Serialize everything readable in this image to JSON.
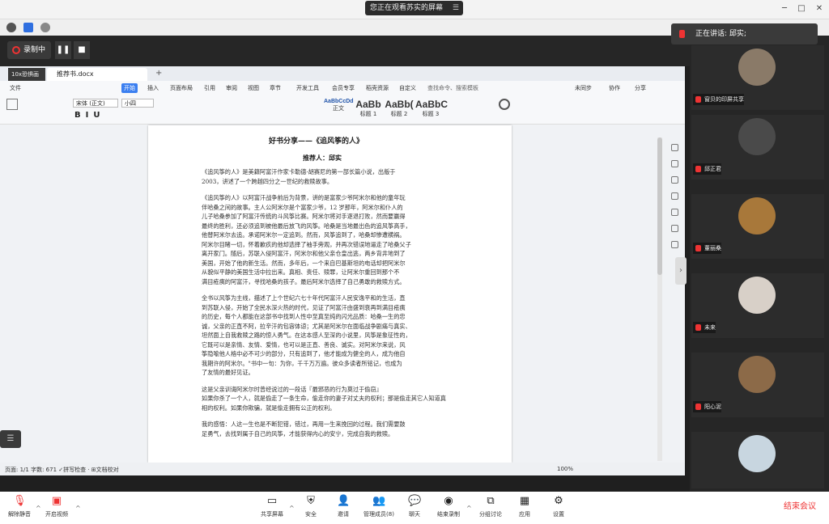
{
  "top": {
    "share_status": "您正在观看苏实的屏幕",
    "share_menu": "☰",
    "win_min": "─",
    "win_max": "□",
    "win_close": "✕"
  },
  "recording": {
    "label": "录制中",
    "pause": "❚❚",
    "stop": "■"
  },
  "tooltip": {
    "label": "10x恐惧画"
  },
  "wps": {
    "doc_tab": "推荐书.docx",
    "menus": [
      "文件",
      "开始",
      "插入",
      "页面布局",
      "引用",
      "审阅",
      "视图",
      "章节",
      "开发工具",
      "会员专享",
      "稻壳资源",
      "自定义",
      "查找命令、搜索模板"
    ],
    "right_menus": [
      "未同步",
      "协作",
      "分享"
    ],
    "styles": [
      {
        "preview": "AaBbCcDd",
        "name": "正文"
      },
      {
        "preview": "AaBb",
        "name": "标题 1"
      },
      {
        "preview": "AaBb(",
        "name": "标题 2"
      },
      {
        "preview": "AaBbC",
        "name": "标题 3"
      }
    ],
    "font": "宋体 (正文)",
    "size": "小四",
    "status_left": "页面: 1/1   字数: 671   ✓拼写检查 ·   ⊞文档校对",
    "zoom": "100%"
  },
  "doc": {
    "title": "好书分享——《追风筝的人》",
    "author": "推荐人：邱实",
    "lines": [
      "《追风筝的人》是美籍阿富汗作家卡勒德·胡赛尼的第一部长篇小说，出版于",
      "2003，讲述了一个跨越四分之一世纪的救赎故事。",
      "",
      "《追风筝的人》以阿富汗战争前后为背景，讲的是富家少爷阿米尔和他的童年玩",
      "伴哈桑之间的故事。主人公阿米尔是个富家少爷，12 岁那年，阿米尔和仆人的",
      "儿子哈桑参加了阿富汗传统的斗风筝比赛。阿米尔将对手逐退打败，然而要赢得",
      "最终的胜利，还必须追到被他最后放飞的风筝。哈桑是当地最出色的追风筝高手，",
      "他替阿米尔去追。承诺阿米尔一定追到。然而，风筝追到了，哈桑却惨遭横祸。",
      "阿米尔目睹一切，怀着歉疚的他却选择了袖手旁观，并再次错误地逼走了哈桑父子",
      "离开家门。随后，苏联入侵阿富汗，阿米尔和他父亲仓皇出逃，两乡背井地到了",
      "美国，开始了他的新生活。然而，多年后，一个来自巴基斯坦的电话却把阿米尔",
      "从貌似平静的美国生活中拉出来。真相、责任、赎罪，让阿米尔重回到那个不",
      "满目疮痍的阿富汗，寻找哈桑的孩子。最后阿米尔选择了自己勇敢的救赎方式。",
      "",
      "全书以风筝为主线，描述了上个世纪六七十年代阿富汗人民安逸平和的生活，直",
      "到苏联入侵，开始了全民水深火热的时代，见证了阿富汗由盛到衰再到满目疮痍",
      "的历史，每个人都能在这部书中找到人性中至真至纯的闪光品质：哈桑一生的忠",
      "诚，父亲的正直不阿，拉辛汗的包容体谅；尤其是阿米尔在面临战争剧痛与真实、",
      "坦然面上自我救赎之路的惊人勇气。在这本感人至深的小说里，风筝是象征性的，",
      "它既可以是亲情、友情、爱情，也可以是正直、善良、诚实。对阿米尔来说，风",
      "筝隐喻他人格中必不可少的部分，只有追到了，他才能成为健全的人，成为他自",
      "我期许的阿米尔。\"书中一句：为你，千千万万遍。彼众多读者所铭记，也成为",
      "了友情的最好见证。",
      "",
      "这是父亲训诲阿米尔时曾经说过的一段话『最邪恶的行为莫过于偷窃』",
      "如果你杀了一个人，就是偷走了一条生命，偷走你的妻子对丈夫的权利；那是偷走其它人知道真",
      "相的权利。如果你欺骗，就是偷走拥有公正的权利。",
      "",
      "我的感悟：人这一生也是不断犯错，错过，再用一生来挽回的过程。我们需要鼓",
      "足勇气，去找到属于自己的风筝，才能获得内心的安宁，完成自我的救赎。"
    ]
  },
  "panel": {
    "speaking": "正在讲话: 邱实;",
    "participants": [
      {
        "name": "窗贝的印屏共享",
        "color": "#8a7a68"
      },
      {
        "name": "邱正君",
        "color": "#4a4a4a"
      },
      {
        "name": "董丽桑",
        "color": "#a8783a"
      },
      {
        "name": "未来",
        "color": "#d8d0c8"
      },
      {
        "name": "阳心泥",
        "color": "#8c6a48"
      },
      {
        "name": "",
        "color": "#c8d6e0"
      }
    ]
  },
  "bottom": {
    "unmute": "解除静音",
    "video": "开启视频",
    "share": "共享屏幕",
    "security": "安全",
    "invite": "邀请",
    "members": "管理成员(8)",
    "chat": "聊天",
    "record": "结束录制",
    "breakout": "分组讨论",
    "apps": "应用",
    "settings": "设置",
    "end": "结束会议"
  }
}
